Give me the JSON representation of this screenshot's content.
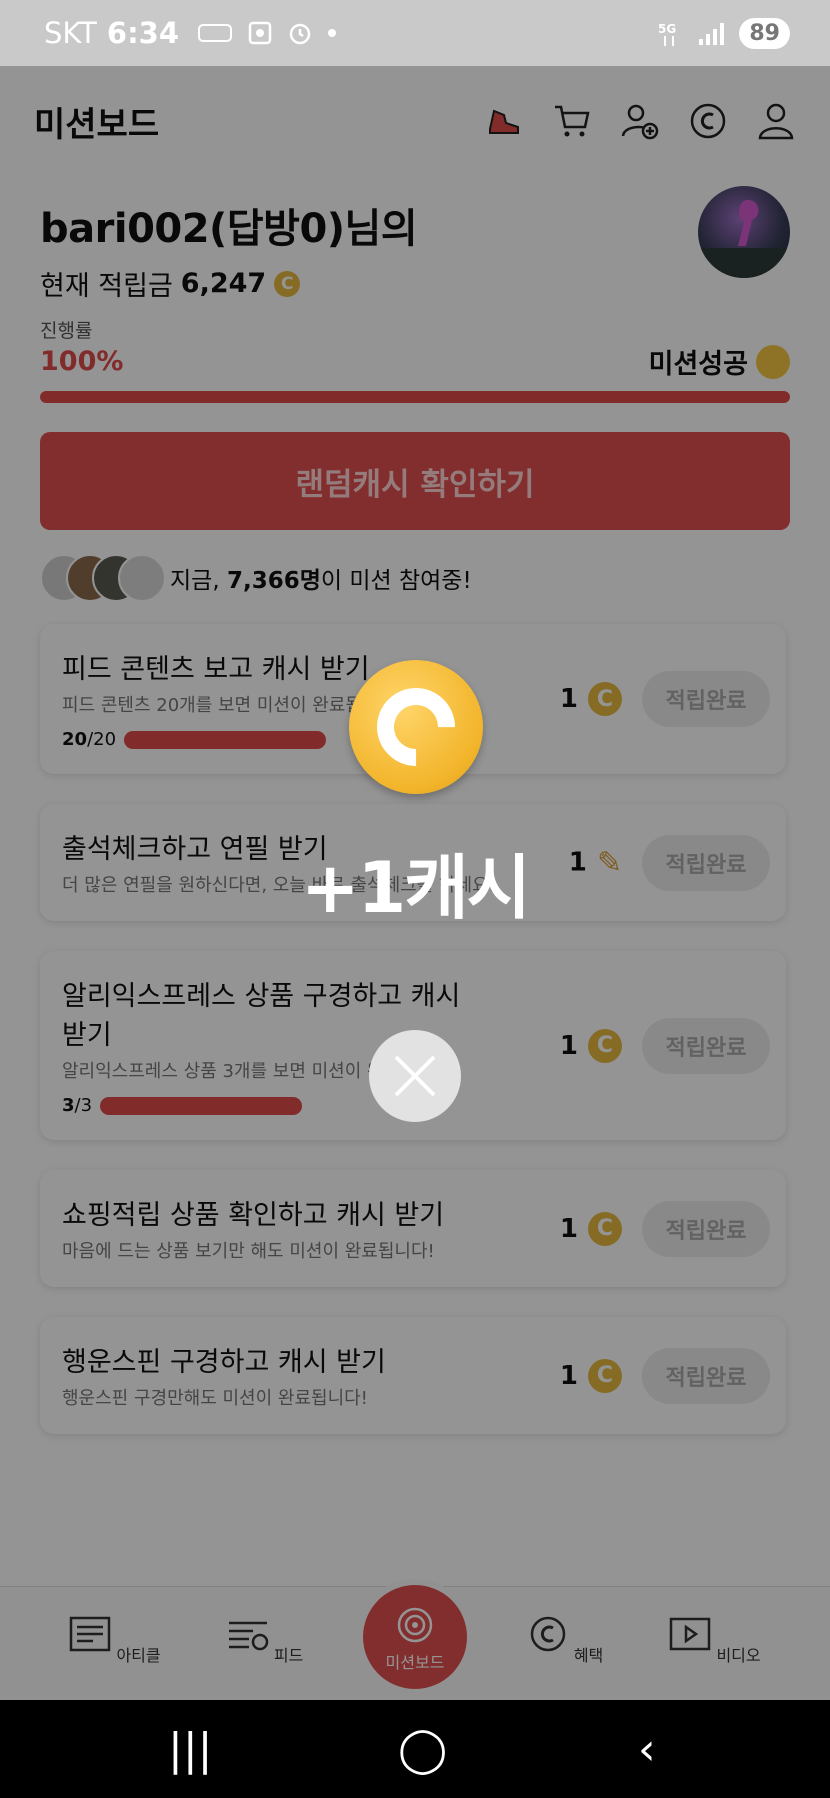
{
  "status_bar": {
    "carrier": "SKT",
    "time": "6:34",
    "battery": "89",
    "network": "5G"
  },
  "header": {
    "title": "미션보드",
    "icons": [
      "shoe-icon",
      "cart-icon",
      "add-user-icon",
      "cash-icon",
      "profile-icon"
    ]
  },
  "profile": {
    "username": "bari002(답방0)님의",
    "balance_label": "현재 적립금",
    "balance": "6,247",
    "coin_symbol": "C"
  },
  "progress": {
    "label": "진행률",
    "value_text": "100%",
    "fraction": 1.0,
    "status": "미션성공"
  },
  "random_button": {
    "label": "랜덤캐시 확인하기"
  },
  "participants": {
    "prefix": "지금, ",
    "count": "7,366명",
    "suffix": "이 미션 참여중!"
  },
  "missions": [
    {
      "title": "피드 콘텐츠 보고 캐시 받기",
      "desc": "피드 콘텐츠 20개를 보면 미션이 완료됩니다!",
      "done": "20",
      "total": "/20",
      "reward": "1",
      "reward_icon": "coin-icon",
      "status": "적립완료"
    },
    {
      "title": "출석체크하고 연필 받기",
      "desc": "더 많은 연필을 원하신다면, 오늘 바로 출석체크를 하세요!",
      "reward": "1",
      "reward_icon": "pencil-icon",
      "status": "적립완료"
    },
    {
      "title": "알리익스프레스 상품 구경하고 캐시받기",
      "desc": "알리익스프레스 상품 3개를 보면 미션이 완료됩니다!",
      "done": "3",
      "total": "/3",
      "reward": "1",
      "reward_icon": "coin-icon",
      "status": "적립완료"
    },
    {
      "title": "쇼핑적립 상품 확인하고 캐시 받기",
      "desc": "마음에 드는 상품 보기만 해도 미션이 완료됩니다!",
      "reward": "1",
      "reward_icon": "coin-icon",
      "status": "적립완료"
    },
    {
      "title": "행운스핀 구경하고 캐시 받기",
      "desc": "행운스핀 구경만해도 미션이 완료됩니다!",
      "reward": "1",
      "reward_icon": "coin-icon",
      "status": "적립완료"
    }
  ],
  "popup": {
    "reward_text": "+1캐시"
  },
  "bottom_nav": [
    {
      "label": "아티클",
      "icon": "article-icon"
    },
    {
      "label": "피드",
      "icon": "feed-icon"
    },
    {
      "label": "미션보드",
      "icon": "target-icon",
      "active": true
    },
    {
      "label": "혜택",
      "icon": "benefit-icon"
    },
    {
      "label": "비디오",
      "icon": "video-icon"
    }
  ],
  "system_nav": {
    "recents": "|||",
    "home": "◯",
    "back": "‹"
  },
  "colors": {
    "accent": "#e04a4a",
    "coin": "#e6b93f"
  }
}
